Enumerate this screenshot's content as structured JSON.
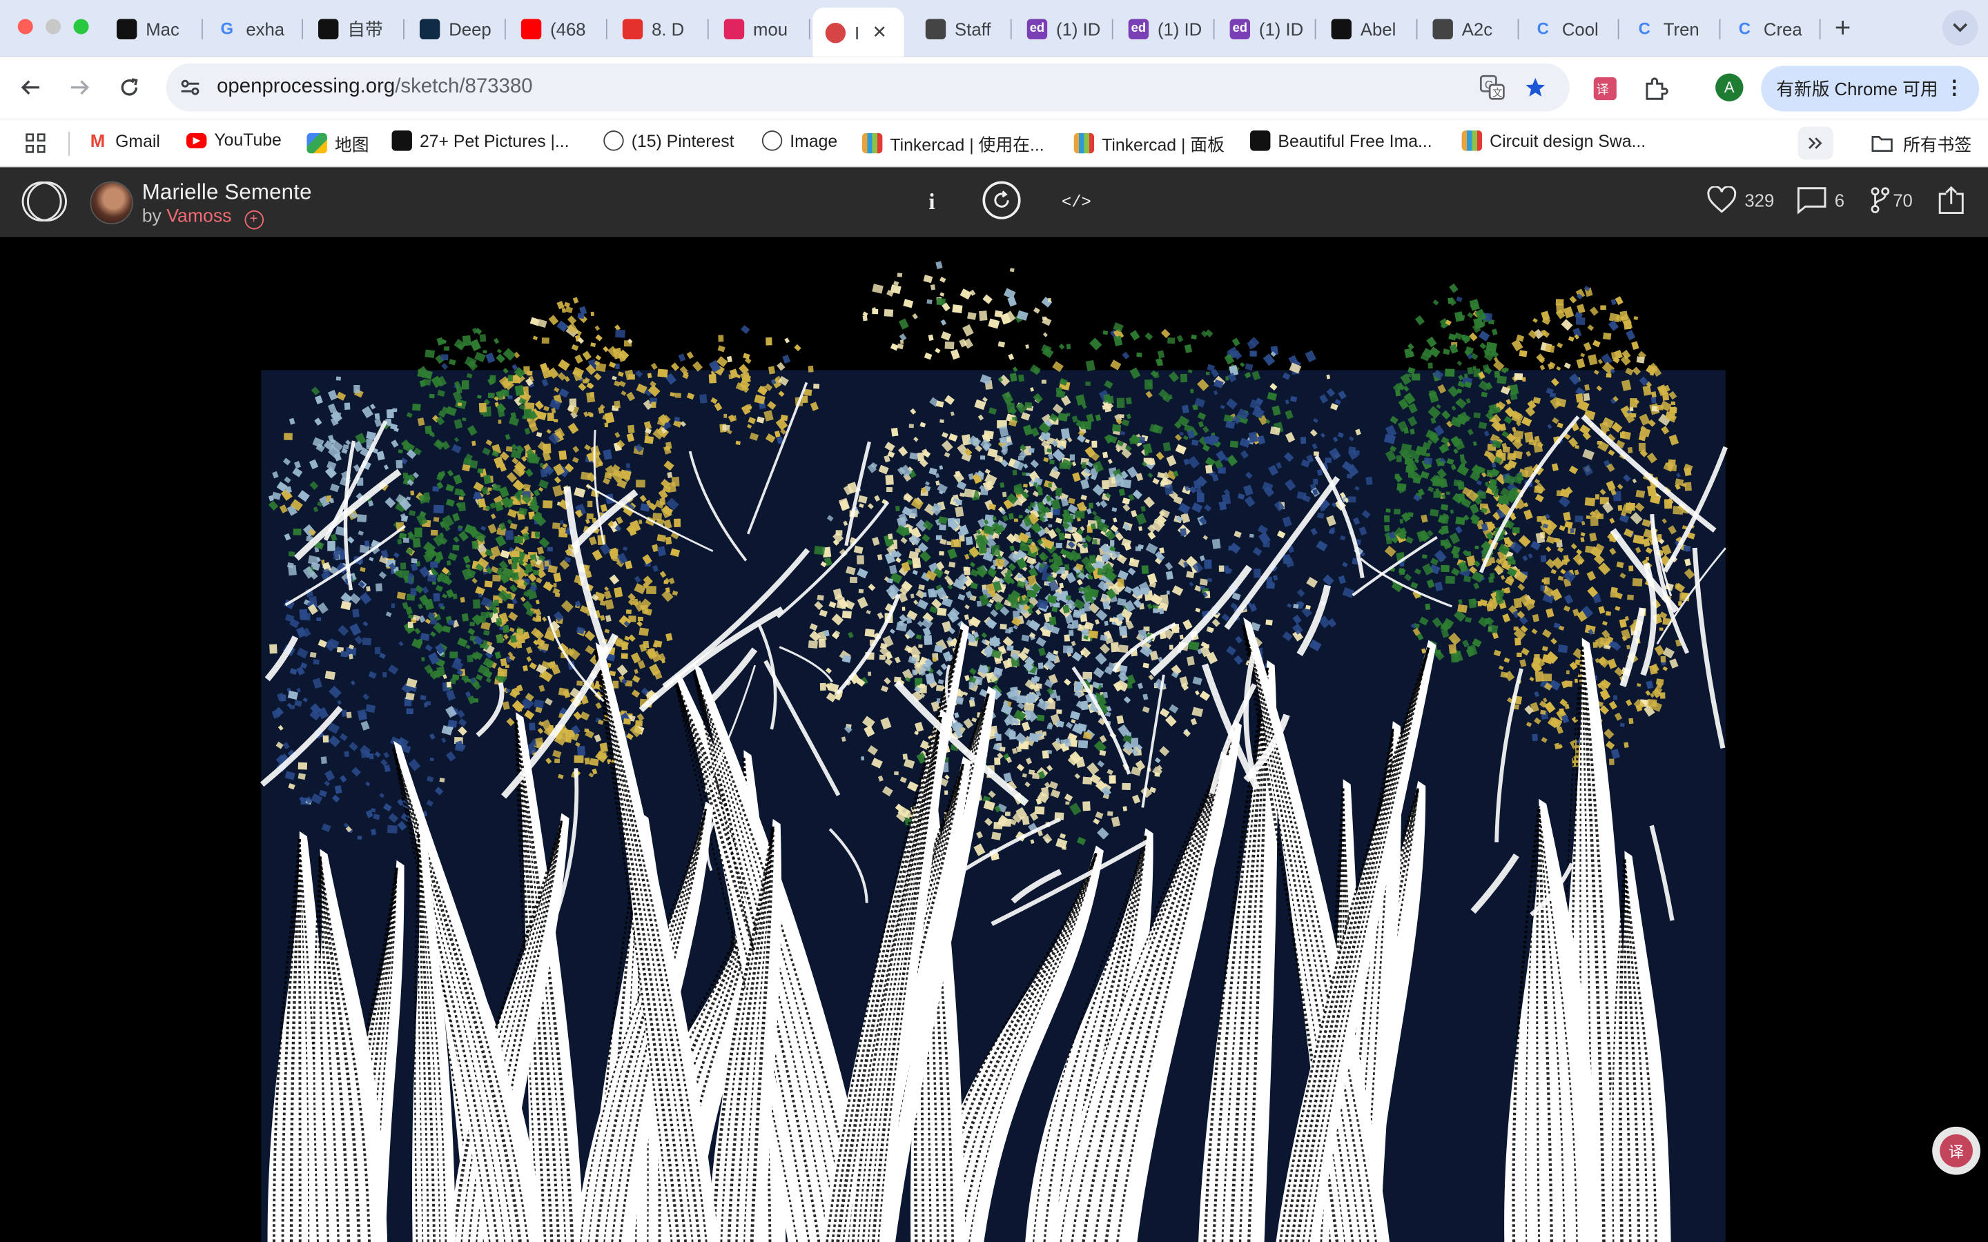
{
  "tabs": [
    {
      "label": "Mac",
      "icon": "mac-icon",
      "color": "#111111"
    },
    {
      "label": "exha",
      "icon": "google-icon",
      "color": "#4285f4"
    },
    {
      "label": "自带",
      "icon": "openai-icon",
      "color": "#111111"
    },
    {
      "label": "Deep",
      "icon": "deepl-icon",
      "color": "#0f2b46"
    },
    {
      "label": "(468",
      "icon": "youtube-icon",
      "color": "#ff0000"
    },
    {
      "label": "8. D",
      "icon": "opera-icon",
      "color": "#e4312b"
    },
    {
      "label": "mou",
      "icon": "asterisk-icon",
      "color": "#e0245e"
    },
    {
      "label": "I",
      "icon": "openprocessing-icon",
      "color": "#d64545",
      "active": true
    },
    {
      "label": "Staff",
      "icon": "shield-icon",
      "color": "#444444"
    },
    {
      "label": "(1) ID",
      "icon": "ed-icon",
      "color": "#7b3fb5"
    },
    {
      "label": "(1) ID",
      "icon": "ed-icon",
      "color": "#7b3fb5"
    },
    {
      "label": "(1) ID",
      "icon": "ed-icon",
      "color": "#7b3fb5"
    },
    {
      "label": "Abel",
      "icon": "github-icon",
      "color": "#111111"
    },
    {
      "label": "A2c",
      "icon": "shield-icon",
      "color": "#444444"
    },
    {
      "label": "Cool",
      "icon": "colab-icon",
      "color": "#4285f4"
    },
    {
      "label": "Tren",
      "icon": "colab-icon",
      "color": "#4285f4"
    },
    {
      "label": "Crea",
      "icon": "colab-icon",
      "color": "#4285f4"
    }
  ],
  "toolbar": {
    "url_host": "openprocessing.org",
    "url_path": "/sketch/873380",
    "update_label": "有新版 Chrome 可用",
    "profile_initial": "A"
  },
  "bookmarks": [
    {
      "label": "Gmail",
      "icon": "gmail-icon",
      "color": "#ea4335"
    },
    {
      "label": "YouTube",
      "icon": "youtube-icon",
      "color": "#ff0000"
    },
    {
      "label": "地图",
      "icon": "maps-icon",
      "color": "#34a853"
    },
    {
      "label": "27+ Pet Pictures |...",
      "icon": "unsplash-icon",
      "color": "#111111"
    },
    {
      "label": "(15) Pinterest",
      "icon": "globe-icon",
      "color": "#3c4043"
    },
    {
      "label": "Image",
      "icon": "globe-icon",
      "color": "#3c4043"
    },
    {
      "label": "Tinkercad | 使用在...",
      "icon": "tinkercad-icon",
      "color": "#e8a33d"
    },
    {
      "label": "Tinkercad | 面板",
      "icon": "tinkercad-icon",
      "color": "#e8a33d"
    },
    {
      "label": "Beautiful Free Ima...",
      "icon": "unsplash-icon",
      "color": "#111111"
    },
    {
      "label": "Circuit design Swa...",
      "icon": "tinkercad-icon",
      "color": "#e8a33d"
    }
  ],
  "bookmarks_folder": "所有书签",
  "sketch": {
    "title": "Marielle Semente",
    "by_label": "by",
    "author": "Vamoss",
    "likes": "329",
    "comments": "6",
    "forks": "70",
    "info_label": "i",
    "code_label": "</>"
  },
  "artwork": {
    "background": "#000000",
    "sky_color": "#0b1630",
    "palette": [
      "#f3e7b5",
      "#9bbad0",
      "#2e7d32",
      "#d4b545",
      "#2a4a8a"
    ],
    "trunk_color": "#ffffff"
  }
}
